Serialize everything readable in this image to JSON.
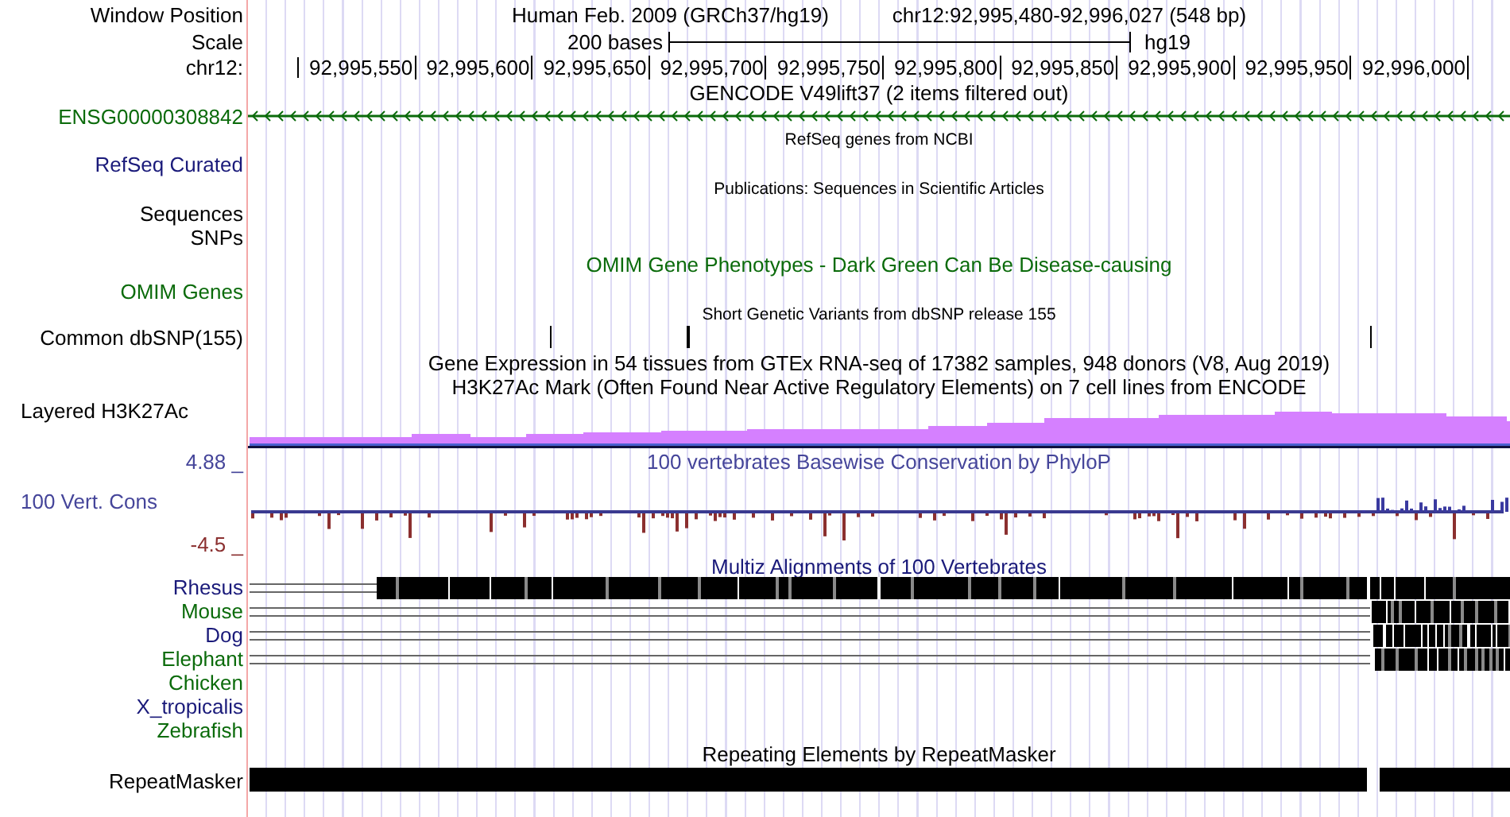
{
  "header": {
    "label": "Window Position",
    "assembly": "Human Feb. 2009 (GRCh37/hg19)",
    "position": "chr12:92,995,480-92,996,027 (548 bp)"
  },
  "scale": {
    "label": "Scale",
    "length": "200 bases",
    "assembly": "hg19"
  },
  "ruler": {
    "label": "chr12:",
    "ticks": [
      "92,995,550",
      "92,995,600",
      "92,995,650",
      "92,995,700",
      "92,995,750",
      "92,995,800",
      "92,995,850",
      "92,995,900",
      "92,995,950",
      "92,996,000"
    ]
  },
  "gencode": {
    "title": "GENCODE V49lift37 (2 items filtered out)",
    "label": "ENSG00000308842"
  },
  "refseq": {
    "title": "RefSeq genes from NCBI",
    "label": "RefSeq Curated"
  },
  "publications": {
    "title": "Publications: Sequences in Scientific Articles",
    "labels": [
      "Sequences",
      "SNPs"
    ]
  },
  "omim": {
    "title": "OMIM Gene Phenotypes - Dark Green Can Be Disease-causing",
    "label": "OMIM Genes"
  },
  "dbsnp": {
    "title": "Short Genetic Variants from dbSNP release 155",
    "label": "Common dbSNP(155)"
  },
  "gtex": {
    "title": "Gene Expression in 54 tissues from GTEx RNA-seq of 17382 samples, 948 donors (V8, Aug 2019)"
  },
  "h3k27ac": {
    "title": "H3K27Ac Mark (Often Found Near Active Regulatory Elements) on 7 cell lines from ENCODE",
    "label": "Layered H3K27Ac"
  },
  "phylop": {
    "title": "100 vertebrates Basewise Conservation by PhyloP",
    "label": "100 Vert. Cons",
    "max": "4.88 _",
    "min": "-4.5 _"
  },
  "multiz": {
    "title": "Multiz Alignments of 100 Vertebrates",
    "species": [
      {
        "name": "Rhesus",
        "color": "#1a1a7a",
        "kind": "full"
      },
      {
        "name": "Mouse",
        "color": "#0b6b0b",
        "kind": "partial"
      },
      {
        "name": "Dog",
        "color": "#1a1a7a",
        "kind": "partial"
      },
      {
        "name": "Elephant",
        "color": "#0b6b0b",
        "kind": "partial"
      },
      {
        "name": "Chicken",
        "color": "#0b6b0b",
        "kind": "none"
      },
      {
        "name": "X_tropicalis",
        "color": "#1a1a7a",
        "kind": "none"
      },
      {
        "name": "Zebrafish",
        "color": "#0b6b0b",
        "kind": "none"
      }
    ]
  },
  "repeatmasker": {
    "title": "Repeating Elements by RepeatMasker",
    "label": "RepeatMasker"
  }
}
